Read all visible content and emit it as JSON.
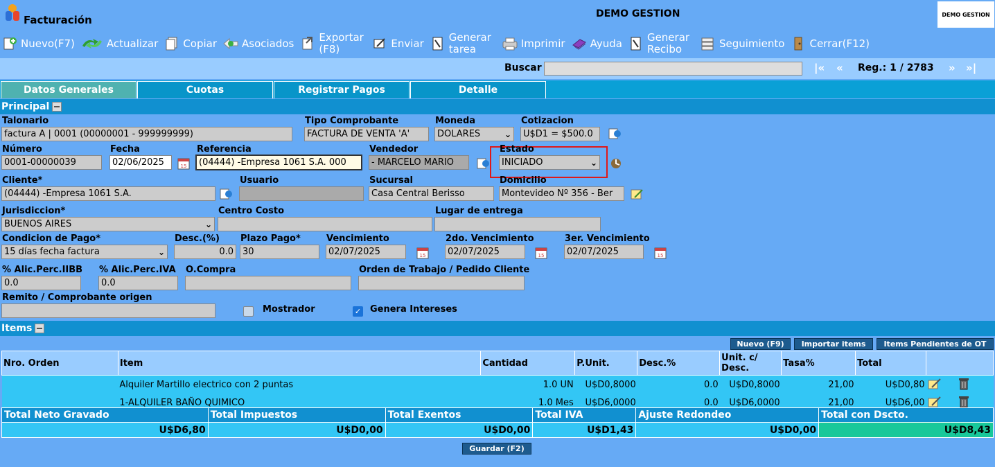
{
  "app": {
    "title": "Facturación",
    "company": "DEMO GESTION",
    "logo_text": "DEMO GESTION"
  },
  "toolbar": [
    {
      "icon": "new-icon",
      "label": "Nuevo(F7)"
    },
    {
      "icon": "refresh-icon",
      "label": "Actualizar"
    },
    {
      "icon": "copy-icon",
      "label": "Copiar"
    },
    {
      "icon": "associated-icon",
      "label": "Asociados"
    },
    {
      "icon": "export-icon",
      "label": "Exportar (F8)"
    },
    {
      "icon": "send-icon",
      "label": "Enviar"
    },
    {
      "icon": "task-icon",
      "label": "Generar tarea"
    },
    {
      "icon": "print-icon",
      "label": "Imprimir"
    },
    {
      "icon": "help-icon",
      "label": "Ayuda"
    },
    {
      "icon": "receipt-icon",
      "label": "Generar Recibo"
    },
    {
      "icon": "tracking-icon",
      "label": "Seguimiento"
    },
    {
      "icon": "close-icon",
      "label": "Cerrar(F12)"
    }
  ],
  "search": {
    "label": "Buscar",
    "value": "",
    "first": "|«",
    "prev": "«",
    "reg": "Reg.: 1 / 2783",
    "next": "»",
    "last": "»|"
  },
  "tabs": [
    "Datos Generales",
    "Cuotas",
    "Registrar Pagos",
    "Detalle"
  ],
  "principal": {
    "title": "Principal",
    "talonario": {
      "label": "Talonario",
      "value": "factura A | 0001 (00000001 - 999999999)"
    },
    "tipo": {
      "label": "Tipo Comprobante",
      "value": "FACTURA DE VENTA 'A'"
    },
    "moneda": {
      "label": "Moneda",
      "value": "DOLARES"
    },
    "cotizacion": {
      "label": "Cotizacion",
      "value": "U$D1 = $500.0"
    },
    "numero": {
      "label": "Número",
      "value": "0001-00000039"
    },
    "fecha": {
      "label": "Fecha",
      "value": "02/06/2025"
    },
    "referencia": {
      "label": "Referencia",
      "value": "(04444) -Empresa 1061 S.A. 000"
    },
    "vendedor": {
      "label": "Vendedor",
      "value": "- MARCELO MARIO"
    },
    "estado": {
      "label": "Estado",
      "value": "INICIADO"
    },
    "cliente": {
      "label": "Cliente*",
      "value": "(04444) -Empresa 1061 S.A."
    },
    "usuario": {
      "label": "Usuario",
      "value": ""
    },
    "sucursal": {
      "label": "Sucursal",
      "value": "Casa Central Berisso"
    },
    "domicilio": {
      "label": "Domicilio",
      "value": "Montevideo Nº 356 - Ber"
    },
    "jurisdiccion": {
      "label": "Jurisdiccion*",
      "value": "BUENOS AIRES"
    },
    "centro": {
      "label": "Centro Costo",
      "value": ""
    },
    "lugar": {
      "label": "Lugar de entrega",
      "value": ""
    },
    "condicion": {
      "label": "Condicion de Pago*",
      "value": "15 días fecha factura"
    },
    "desc": {
      "label": "Desc.(%)",
      "value": "0.0"
    },
    "plazo": {
      "label": "Plazo Pago*",
      "value": "30"
    },
    "venc": {
      "label": "Vencimiento",
      "value": "02/07/2025"
    },
    "venc2": {
      "label": "2do. Vencimiento",
      "value": "02/07/2025"
    },
    "venc3": {
      "label": "3er. Vencimiento",
      "value": "02/07/2025"
    },
    "iibb": {
      "label": "% Alic.Perc.IIBB",
      "value": "0.0"
    },
    "iva": {
      "label": "% Alic.Perc.IVA",
      "value": "0.0"
    },
    "ocompra": {
      "label": "O.Compra",
      "value": ""
    },
    "orden": {
      "label": "Orden de Trabajo / Pedido Cliente",
      "value": ""
    },
    "remito": {
      "label": "Remito / Comprobante origen",
      "value": ""
    },
    "mostrador": {
      "label": "Mostrador",
      "checked": false
    },
    "intereses": {
      "label": "Genera Intereses",
      "checked": true
    }
  },
  "items": {
    "title": "Items",
    "buttons": [
      "Nuevo (F9)",
      "Importar items",
      "Items Pendientes de OT"
    ],
    "columns": [
      "Nro. Orden",
      "Item",
      "Cantidad",
      "P.Unit.",
      "Desc.%",
      "Unit. c/ Desc.",
      "Tasa%",
      "Total"
    ],
    "rows": [
      {
        "orden": "",
        "item": "Alquiler Martillo electrico con 2 puntas",
        "cantidad": "1.0 UN",
        "punit": "U$D0,8000",
        "desc": "0.0",
        "unitdesc": "U$D0,8000",
        "tasa": "21,00",
        "total": "U$D0,80"
      },
      {
        "orden": "",
        "item": "1-ALQUILER BAÑO QUIMICO",
        "cantidad": "1.0 Mes",
        "punit": "U$D6,0000",
        "desc": "0.0",
        "unitdesc": "U$D6,0000",
        "tasa": "21,00",
        "total": "U$D6,00"
      }
    ]
  },
  "totals": {
    "headers": [
      "Total Neto Gravado",
      "Total Impuestos",
      "Total Exentos",
      "Total IVA",
      "Ajuste Redondeo",
      "Total con Dscto."
    ],
    "values": [
      "U$D6,80",
      "U$D0,00",
      "U$D0,00",
      "U$D1,43",
      "U$D0,00",
      "U$D8,43"
    ]
  },
  "save_label": "Guardar (F2)"
}
